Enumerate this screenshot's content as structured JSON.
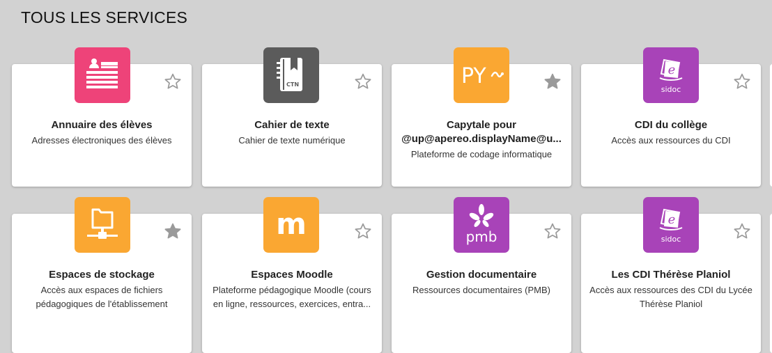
{
  "page": {
    "title": "TOUS LES SERVICES"
  },
  "colors": {
    "background": "#d2d2d2",
    "pink": "#ee4379",
    "grey": "#5b5b5b",
    "orange": "#faa732",
    "purple": "#a843b8",
    "star_outline": "#9a9a9a",
    "star_filled": "#9a9a9a"
  },
  "services": [
    {
      "title": [
        "Annuaire des élèves"
      ],
      "description": [
        "Adresses électroniques des élèves"
      ],
      "icon": "contact-card-icon",
      "icon_text": "",
      "favorite": false
    },
    {
      "title": [
        "Cahier de texte"
      ],
      "description": [
        "Cahier de texte numérique"
      ],
      "icon": "notebook-icon",
      "icon_text": "CTN",
      "favorite": false
    },
    {
      "title": [
        "Capytale pour",
        "@up@apereo.displayName@u..."
      ],
      "description": [
        "Plateforme de codage informatique"
      ],
      "icon": "python-icon",
      "icon_text": "PY",
      "favorite": true
    },
    {
      "title": [
        "CDI du collège"
      ],
      "description": [
        "Accès aux ressources du CDI"
      ],
      "icon": "sidoc-icon",
      "icon_text": "sidoc",
      "favorite": false
    },
    {
      "title": [
        "Espaces de stockage"
      ],
      "description": [
        "Accès aux espaces de fichiers",
        "pédagogiques de l'établissement"
      ],
      "icon": "network-folder-icon",
      "icon_text": "",
      "favorite": true
    },
    {
      "title": [
        "Espaces Moodle"
      ],
      "description": [
        "Plateforme pédagogique Moodle (cours",
        "en ligne, ressources, exercices, entra..."
      ],
      "icon": "moodle-icon",
      "icon_text": "m",
      "favorite": false
    },
    {
      "title": [
        "Gestion documentaire"
      ],
      "description": [
        "Ressources documentaires (PMB)"
      ],
      "icon": "pmb-icon",
      "icon_text": "pmb",
      "favorite": false
    },
    {
      "title": [
        "Les CDI Thérèse Planiol"
      ],
      "description": [
        "Accès aux ressources des CDI du Lycée",
        "Thérèse Planiol"
      ],
      "icon": "sidoc-icon",
      "icon_text": "sidoc",
      "favorite": false
    }
  ]
}
